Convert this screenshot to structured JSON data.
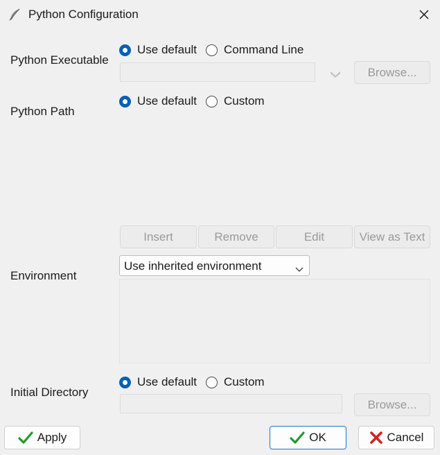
{
  "window": {
    "title": "Python Configuration"
  },
  "executable": {
    "label": "Python Executable",
    "option_default": "Use default",
    "option_alt": "Command Line",
    "browse": "Browse..."
  },
  "path": {
    "label": "Python Path",
    "option_default": "Use default",
    "option_alt": "Custom",
    "buttons": {
      "insert": "Insert",
      "remove": "Remove",
      "edit": "Edit",
      "view_as_text": "View as Text"
    }
  },
  "environment": {
    "label": "Environment",
    "selected": "Use inherited environment"
  },
  "initial_directory": {
    "label": "Initial Directory",
    "option_default": "Use default",
    "option_alt": "Custom",
    "browse": "Browse..."
  },
  "footer": {
    "apply": "Apply",
    "ok": "OK",
    "cancel": "Cancel"
  },
  "colors": {
    "accent": "#005fb8",
    "check_green": "#1e9a2e",
    "cancel_red": "#d62020",
    "ok_border": "#1976d2"
  },
  "icons": {
    "title": "feather-pen-icon",
    "close": "close-icon",
    "apply": "check-icon",
    "ok": "check-icon",
    "cancel": "x-icon"
  }
}
